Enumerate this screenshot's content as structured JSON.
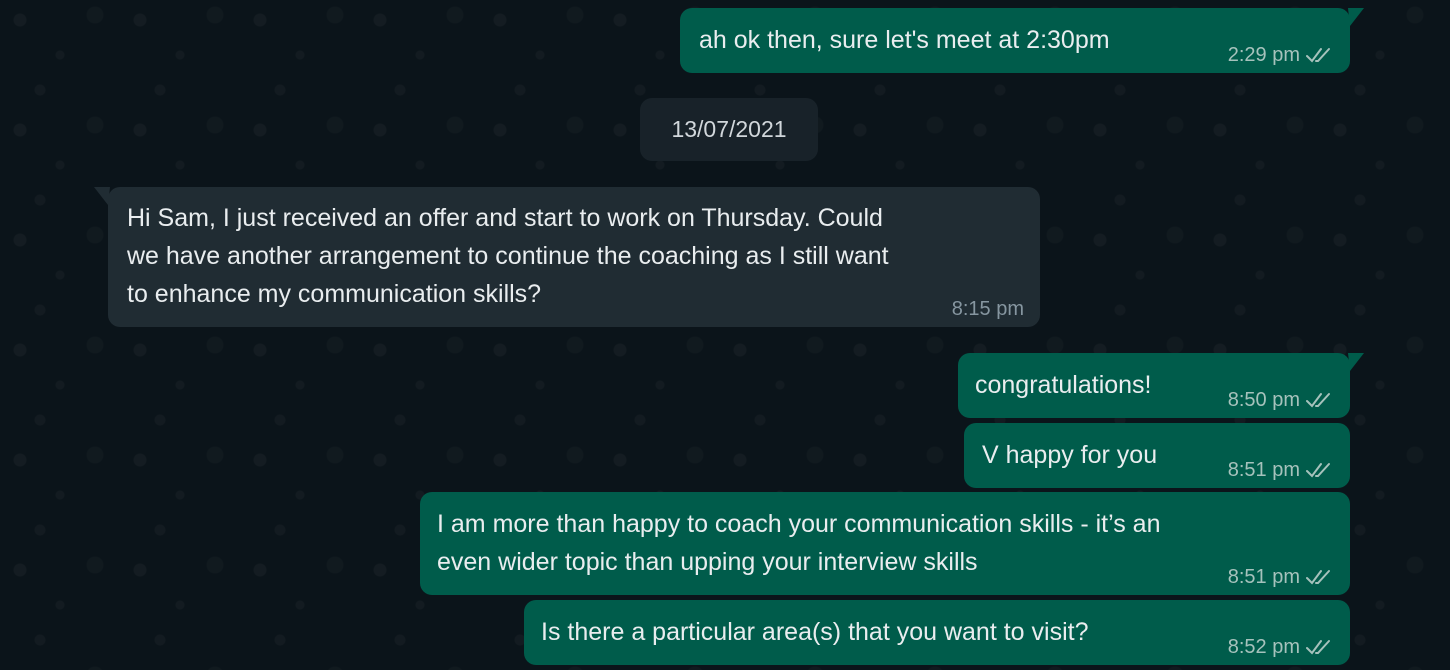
{
  "date_separator": "13/07/2021",
  "messages": [
    {
      "direction": "outgoing",
      "lines": [
        "ah ok then, sure let's meet at 2:30pm"
      ],
      "time": "2:29 pm",
      "status_icon": "double-check-icon"
    },
    {
      "direction": "incoming",
      "lines": [
        "Hi Sam, I just received an offer and start to work on Thursday. Could",
        "we have another arrangement to continue the coaching as I still want",
        "to enhance my communication skills?"
      ],
      "time": "8:15 pm"
    },
    {
      "direction": "outgoing",
      "lines": [
        "congratulations!"
      ],
      "time": "8:50 pm",
      "status_icon": "double-check-icon"
    },
    {
      "direction": "outgoing",
      "lines": [
        "V happy for you"
      ],
      "time": "8:51 pm",
      "status_icon": "double-check-icon"
    },
    {
      "direction": "outgoing",
      "lines": [
        "I am more than happy to coach your communication skills - it’s an",
        "even wider topic than upping your interview skills"
      ],
      "time": "8:51 pm",
      "status_icon": "double-check-icon"
    },
    {
      "direction": "outgoing",
      "lines": [
        "Is there a particular area(s) that you want to visit?"
      ],
      "time": "8:52 pm",
      "status_icon": "double-check-icon"
    }
  ],
  "colors": {
    "background": "#0b141a",
    "outgoing_bubble": "#005c4b",
    "incoming_bubble": "#202c33",
    "date_chip": "#182229",
    "text": "#e9edef"
  }
}
